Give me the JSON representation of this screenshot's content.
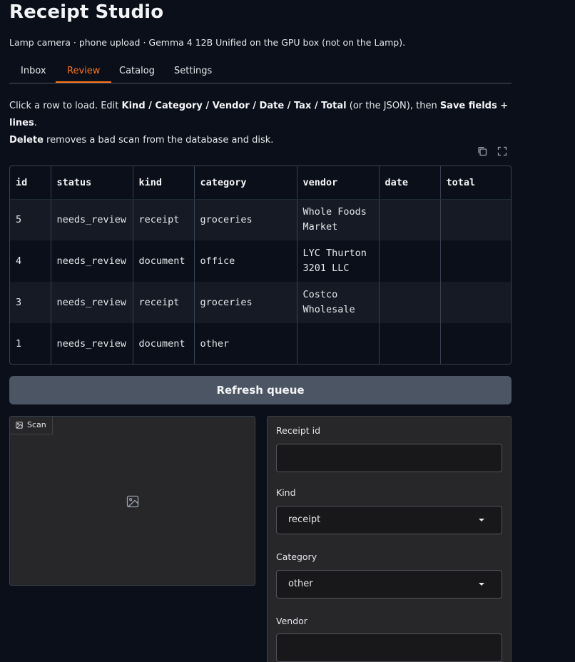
{
  "app": {
    "title": "Receipt Studio",
    "subtitle": "Lamp camera · phone upload · Gemma 4 12B Unified on the GPU box (not on the Lamp)."
  },
  "tabs": [
    {
      "label": "Inbox",
      "active": false
    },
    {
      "label": "Review",
      "active": true
    },
    {
      "label": "Catalog",
      "active": false
    },
    {
      "label": "Settings",
      "active": false
    }
  ],
  "instructions": {
    "line1_a": "Click a row to load. Edit ",
    "line1_b": "Kind / Category / Vendor / Date / Tax / Total",
    "line1_c": " (or the JSON), then ",
    "line1_d": "Save fields + lines",
    "line1_e": ".",
    "line2_a": "Delete",
    "line2_b": " removes a bad scan from the database and disk."
  },
  "toolbar": {
    "copy_icon": "copy-icon",
    "fullscreen_icon": "fullscreen-icon"
  },
  "table": {
    "columns": [
      "id",
      "status",
      "kind",
      "category",
      "vendor",
      "date",
      "total"
    ],
    "rows": [
      {
        "id": "5",
        "status": "needs_review",
        "kind": "receipt",
        "category": "groceries",
        "vendor": "Whole Foods Market",
        "date": "",
        "total": ""
      },
      {
        "id": "4",
        "status": "needs_review",
        "kind": "document",
        "category": "office",
        "vendor": "LYC Thurton 3201 LLC",
        "date": "",
        "total": ""
      },
      {
        "id": "3",
        "status": "needs_review",
        "kind": "receipt",
        "category": "groceries",
        "vendor": "Costco Wholesale",
        "date": "",
        "total": ""
      },
      {
        "id": "1",
        "status": "needs_review",
        "kind": "document",
        "category": "other",
        "vendor": "",
        "date": "",
        "total": ""
      }
    ]
  },
  "refresh_button": {
    "label": "Refresh queue"
  },
  "scan": {
    "label": "Scan",
    "icon": "image-icon"
  },
  "form": {
    "receipt_id": {
      "label": "Receipt id",
      "value": ""
    },
    "kind": {
      "label": "Kind",
      "value": "receipt"
    },
    "category": {
      "label": "Category",
      "value": "other"
    },
    "vendor": {
      "label": "Vendor",
      "value": ""
    }
  },
  "colors": {
    "accent": "#f97316",
    "background": "#0b0f19",
    "button": "#4b5563"
  }
}
